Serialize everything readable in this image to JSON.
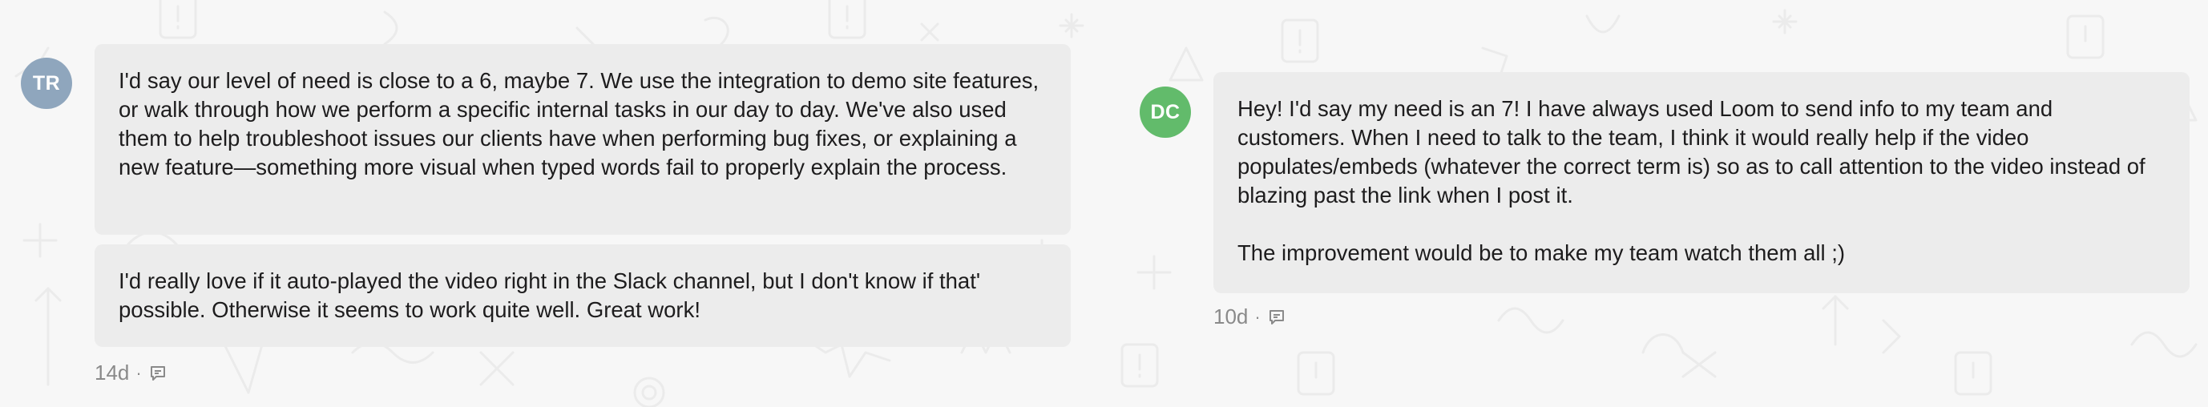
{
  "threads": [
    {
      "avatar": {
        "initials": "TR",
        "color": "#8fa6bd"
      },
      "messages": [
        {
          "paragraphs": [
            "I'd say our level of need is close to a 6, maybe 7. We use the integration to demo site features, or walk through how we perform a specific internal tasks in our day to day. We've also used them to help troubleshoot issues our clients have when performing bug fixes, or explaining a new feature—something more visual when typed words fail to properly explain the process."
          ]
        },
        {
          "paragraphs": [
            "I'd really love if it auto-played the video right in the Slack channel, but I don't know if that' possible. Otherwise it seems to work quite well. Great work!"
          ]
        }
      ],
      "meta": {
        "age": "14d",
        "separator": "·",
        "icon": "comment-icon"
      }
    },
    {
      "avatar": {
        "initials": "DC",
        "color": "#62bb6b"
      },
      "messages": [
        {
          "paragraphs": [
            "Hey! I'd say my need is an 7! I have always used Loom to send info to my team and customers. When I need to talk to the team, I think it would really help if the video populates/embeds (whatever the correct term is) so as to call attention to the video instead of blazing past the link when I post it.",
            "The improvement would be to make my team watch them all ;)"
          ]
        }
      ],
      "meta": {
        "age": "10d",
        "separator": "·",
        "icon": "comment-icon"
      }
    }
  ]
}
